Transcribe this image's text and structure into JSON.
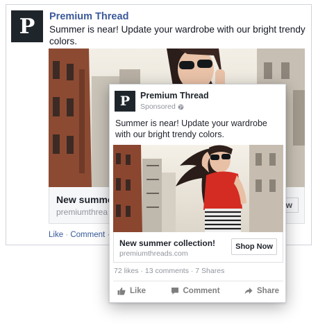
{
  "brand": {
    "page_name": "Premium Thread",
    "logo_letter": "P",
    "logo_bg": "#1f262b",
    "name_color_desktop": "#3b5998"
  },
  "desktop_post": {
    "page_name": "Premium Thread",
    "text": "Summer is near! Update your wardrobe with our bright trendy colors.",
    "link_headline": "New summer",
    "link_url": "premiumthrea",
    "cta_partial": "w",
    "actions": [
      "Like",
      "Comment"
    ]
  },
  "mobile_post": {
    "page_name": "Premium Thread",
    "sponsored": "Sponsored",
    "text": "Summer is near! Update your wardrobe with our bright trendy colors.",
    "link_headline": "New summer collection!",
    "link_url": "premiumthreads.com",
    "cta": "Shop Now",
    "stats": "72 likes · 13 comments · 7 Shares",
    "actions": {
      "like": "Like",
      "comment": "Comment",
      "share": "Share"
    }
  },
  "icons": {
    "globe": "globe-icon",
    "like": "thumbs-up-icon",
    "comment": "comment-icon",
    "share": "share-arrow-icon"
  }
}
